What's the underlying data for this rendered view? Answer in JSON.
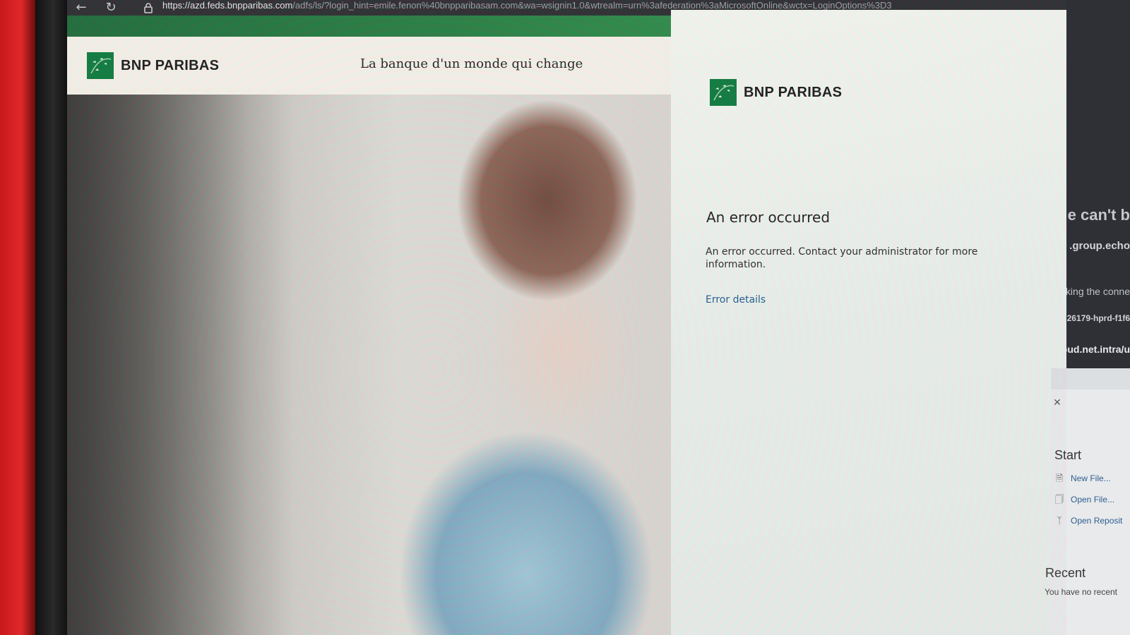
{
  "browser": {
    "url_host": "https://azd.feds.bnpparibas.com",
    "url_rest": "/adfs/ls/?login_hint=emile.fenon%40bnpparibasam.com&wa=wsignin1.0&wtrealm=urn%3afederation%3aMicrosoftOnline&wctx=LoginOptions%3D3"
  },
  "site": {
    "logo_text": "BNP PARIBAS",
    "tagline": "La banque d'un monde qui change"
  },
  "panel": {
    "logo_text": "BNP PARIBAS",
    "error_title": "An error occurred",
    "error_message": "An error occurred. Contact your administrator for more information.",
    "error_details_link": "Error details"
  },
  "other_window": {
    "line1": "e can't b",
    "line2": ".group.echo",
    "line3": "king the conne",
    "line4": "26179-hprd-f1f6",
    "line5": "cloud.net.intra/u"
  },
  "vscode": {
    "start_heading": "Start",
    "new_file": "New File...",
    "open_file": "Open File...",
    "open_repo": "Open Reposit",
    "recent_heading": "Recent",
    "no_recent": "You have no recent"
  },
  "colors": {
    "brand_green": "#0b7a3e",
    "link_blue": "#1f5c8c"
  }
}
